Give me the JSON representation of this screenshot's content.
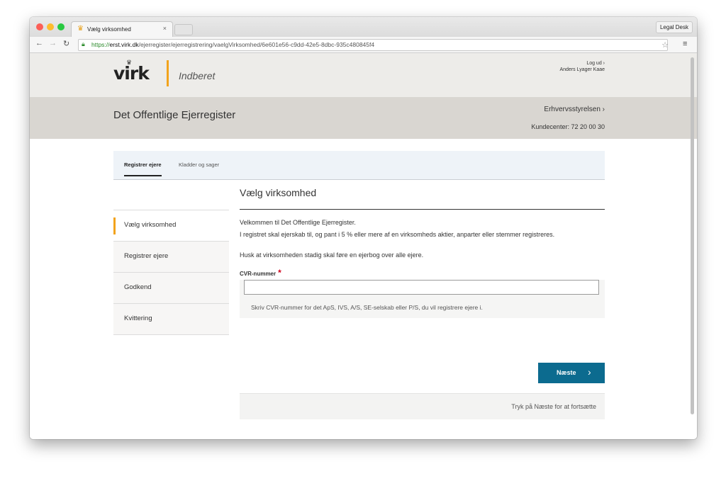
{
  "browser": {
    "tab_title": "Vælg virksomhed",
    "tab_close": "×",
    "profile": "Legal Desk",
    "url_scheme": "https://",
    "url_host": "erst.virk.dk",
    "url_path": "/ejerregister/ejerregistrering/vaelgVirksomhed/6e601e56-c9dd-42e5-8dbc-935c480845f4"
  },
  "header": {
    "logo_text": "virk",
    "logo_sub": "Indberet",
    "logout": "Log ud ›",
    "user_name": "Anders Lyager Kaae",
    "register_title": "Det Offentlige Ejerregister",
    "authority": "Erhvervsstyrelsen ›",
    "phone": "Kundecenter: 72 20 00 30"
  },
  "tabs": [
    {
      "label": "Registrer ejere"
    },
    {
      "label": "Kladder og sager"
    }
  ],
  "steps": [
    {
      "label": "Vælg virksomhed"
    },
    {
      "label": "Registrer ejere"
    },
    {
      "label": "Godkend"
    },
    {
      "label": "Kvittering"
    }
  ],
  "content": {
    "title": "Vælg virksomhed",
    "intro_line1": "Velkommen til Det Offentlige Ejerregister.",
    "intro_line2": "I registret skal ejerskab til, og pant i 5 % eller mere af en virksomheds aktier, anparter eller stemmer registreres.",
    "intro_line3": "Husk at virksomheden stadig skal føre en ejerbog over alle ejere.",
    "cvr_label": "CVR-nummer",
    "cvr_required": "*",
    "cvr_value": "",
    "cvr_help": "Skriv CVR-nummer for det ApS, IVS, A/S, SE-selskab eller P/S, du vil registrere ejere i.",
    "next_label": "Næste",
    "footer_hint": "Tryk på Næste for at fortsætte"
  },
  "colors": {
    "accent": "#f2a31c",
    "button": "#0c6b8f"
  }
}
